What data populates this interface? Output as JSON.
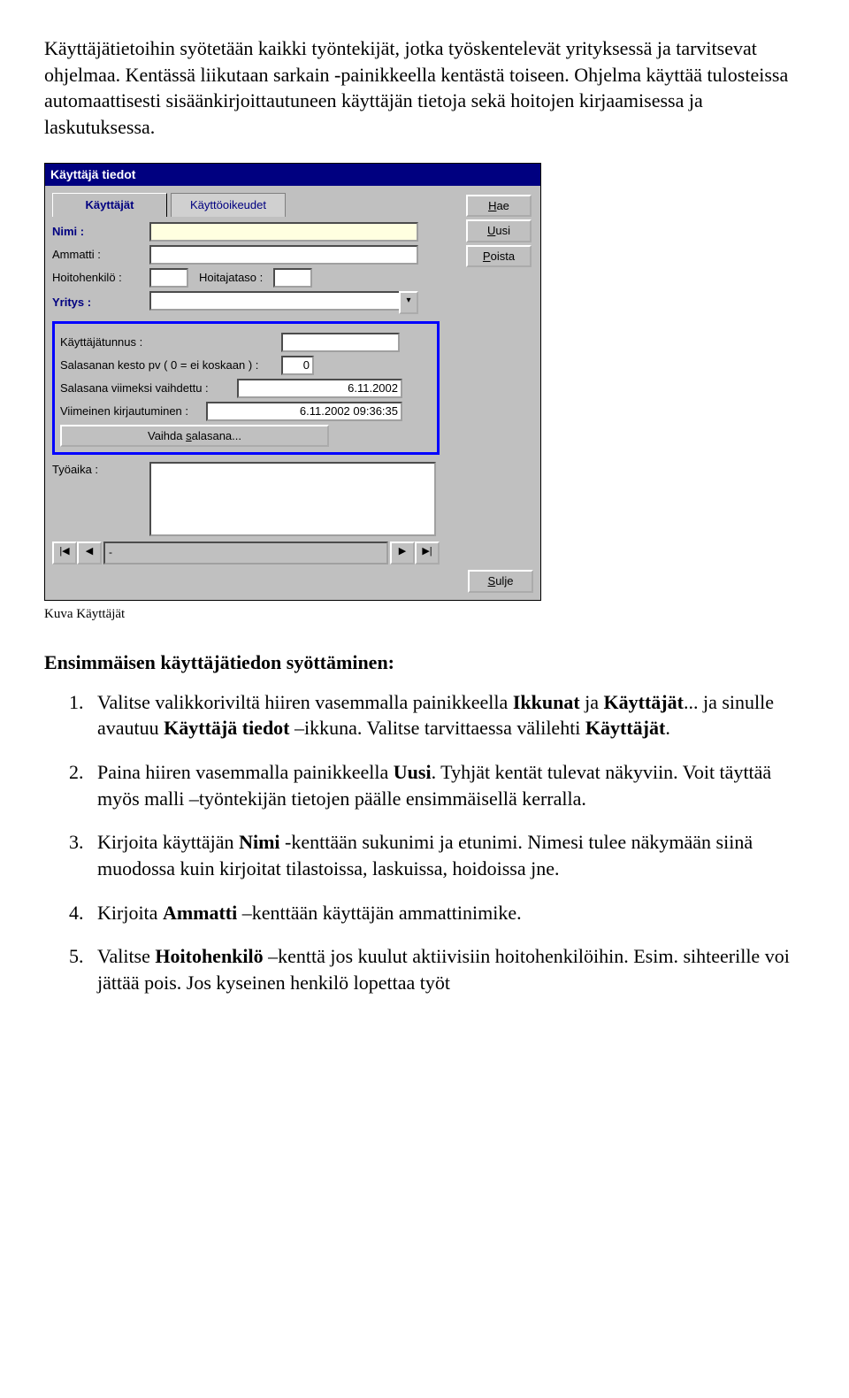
{
  "intro_p1": "Käyttäjätietoihin syötetään kaikki työntekijät, jotka työskentelevät yrityksessä ja tarvitsevat ohjelmaa. Kentässä liikutaan sarkain -painikkeella kentästä toiseen. Ohjelma käyttää tulosteissa automaattisesti sisäänkirjoittautuneen käyttäjän tietoja sekä hoitojen kirjaamisessa ja laskutuksessa.",
  "dialog": {
    "title": "Käyttäjä tiedot",
    "tab1": "Käyttäjät",
    "tab2": "Käyttöoikeudet",
    "btn_hae": "Hae",
    "btn_uusi": "Uusi",
    "btn_poista": "Poista",
    "btn_sulje": "Sulje",
    "lbl_nimi": "Nimi :",
    "lbl_ammatti": "Ammatti :",
    "lbl_hoitohenkilo": "Hoitohenkilö :",
    "lbl_hoitajataso": "Hoitajataso :",
    "lbl_yritys": "Yritys :",
    "lbl_kayttajatunnus": "Käyttäjätunnus :",
    "lbl_salasana_kesto": "Salasanan kesto pv ( 0 = ei koskaan ) :",
    "val_salasana_kesto": "0",
    "lbl_salasana_vaih": "Salasana viimeksi vaihdettu :",
    "val_salasana_vaih": "6.11.2002",
    "lbl_viim_kirj": "Viimeinen kirjautuminen :",
    "val_viim_kirj": "6.11.2002 09:36:35",
    "btn_vaihda": "Vaihda salasana...",
    "lbl_tyoaika": "Työaika :",
    "nav_text": "-"
  },
  "caption": "Kuva Käyttäjät",
  "heading": "Ensimmäisen käyttäjätiedon syöttäminen:",
  "li1_a": "Valitse valikkoriviltä hiiren vasemmalla painikkeella ",
  "li1_b": "Ikkunat ",
  "li1_c": "ja      ",
  "li1_d": "Käyttäjät",
  "li1_e": "... ja  sinulle avautuu ",
  "li1_f": "Käyttäjä tiedot",
  "li1_g": " –ikkuna. Valitse tarvittaessa välilehti ",
  "li1_h": "Käyttäjät",
  "li1_i": ".",
  "li2_a": "Paina hiiren vasemmalla painikkeella ",
  "li2_b": "Uusi",
  "li2_c": ". Tyhjät kentät tulevat näkyviin. Voit täyttää myös malli –työntekijän tietojen päälle ensimmäisellä kerralla.",
  "li3_a": "Kirjoita käyttäjän ",
  "li3_b": "Nimi",
  "li3_c": " -kenttään sukunimi ja etunimi. Nimesi tulee näkymään siinä muodossa kuin kirjoitat  tilastoissa, laskuissa, hoidoissa jne.",
  "li4_a": "Kirjoita ",
  "li4_b": "Ammatti",
  "li4_c": " –kenttään  käyttäjän ammattinimike.",
  "li5_a": "Valitse ",
  "li5_b": "Hoitohenkilö",
  "li5_c": " –kenttä jos kuulut aktiivisiin hoitohenkilöihin. Esim. sihteerille voi jättää pois. Jos kyseinen henkilö lopettaa työt"
}
